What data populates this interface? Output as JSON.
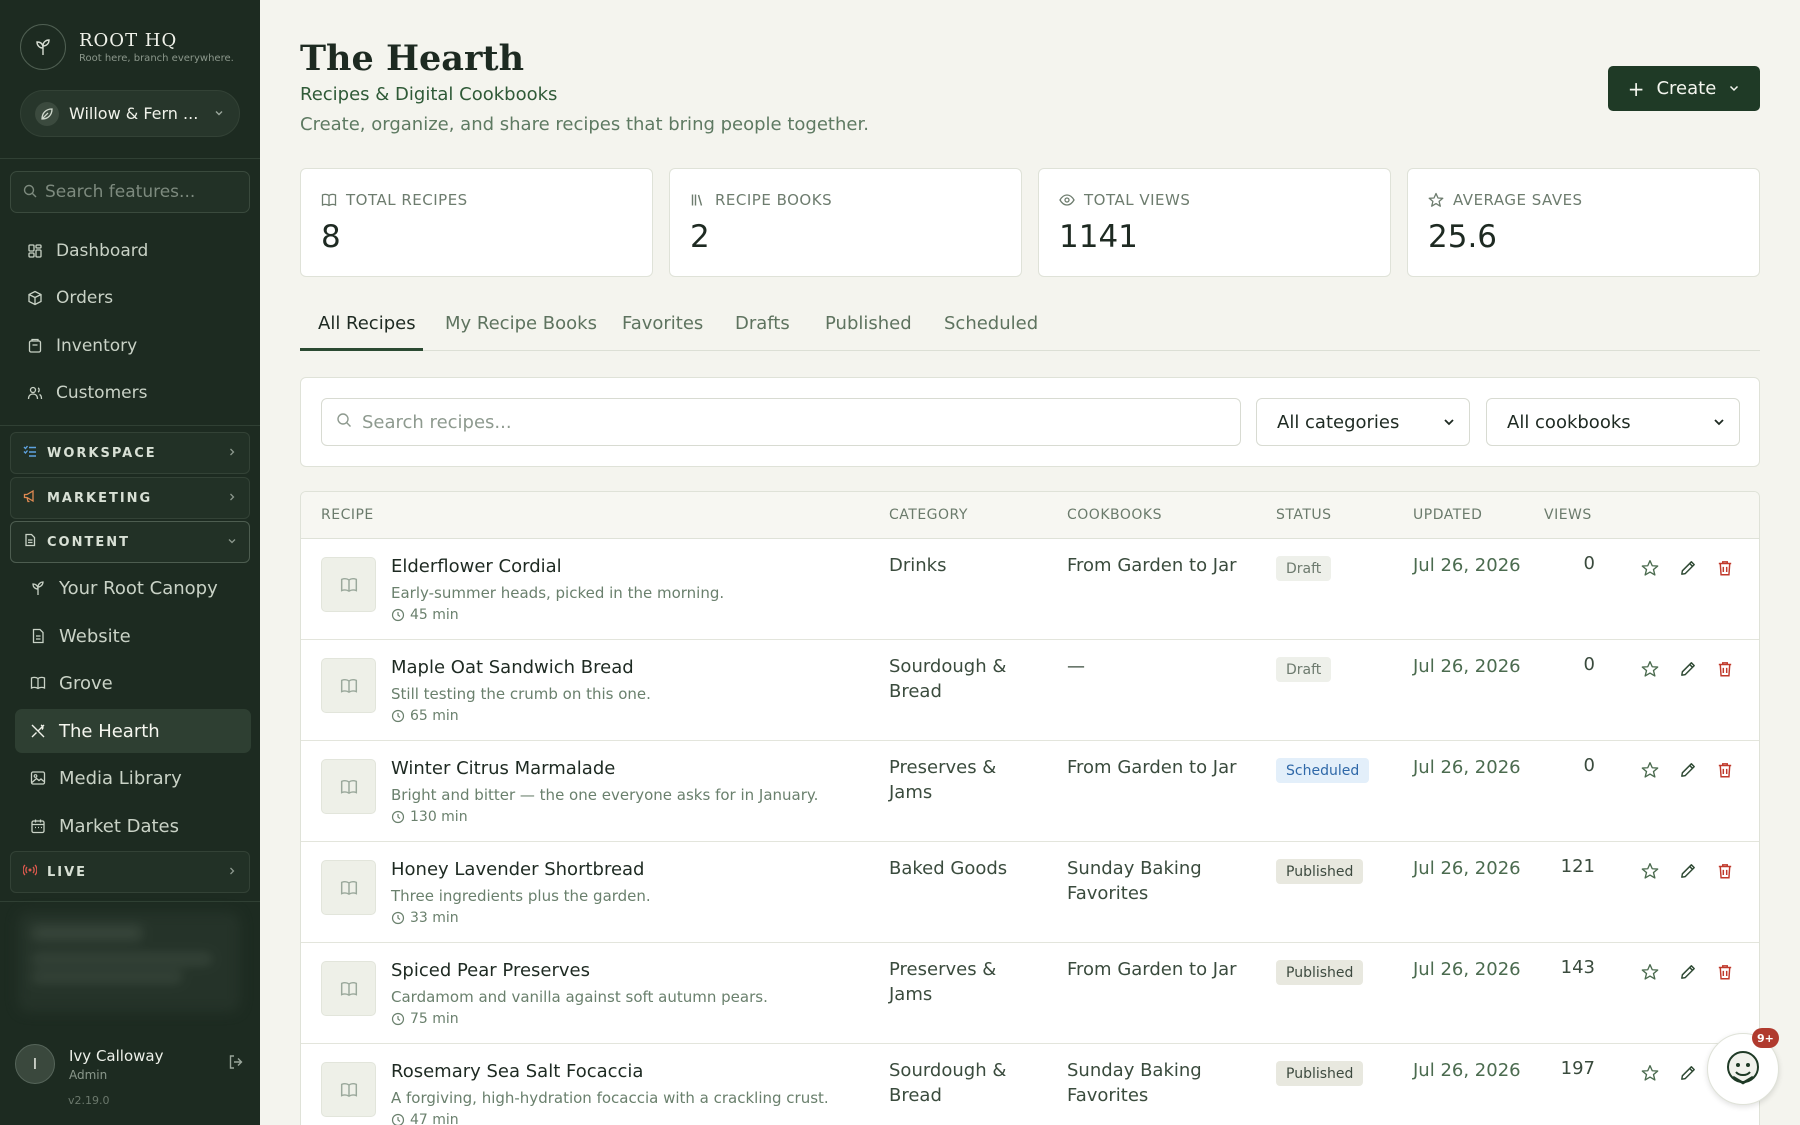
{
  "sidebar": {
    "brand_name": "ROOT HQ",
    "brand_tagline": "Root here, branch everywhere.",
    "account_name": "Willow & Fern ...",
    "search_placeholder": "Search features...",
    "nav_top": [
      {
        "label": "Dashboard",
        "icon": "dashboard-icon"
      },
      {
        "label": "Orders",
        "icon": "package-icon"
      },
      {
        "label": "Inventory",
        "icon": "inventory-icon"
      },
      {
        "label": "Customers",
        "icon": "users-icon"
      }
    ],
    "groups": [
      {
        "label": "WORKSPACE",
        "icon": "list-check-icon",
        "icon_color": "#5fa3e0"
      },
      {
        "label": "MARKETING",
        "icon": "megaphone-icon",
        "icon_color": "#e08a52"
      },
      {
        "label": "CONTENT",
        "icon": "document-icon",
        "icon_color": "#c9d2c6"
      },
      {
        "label": "LIVE",
        "icon": "broadcast-icon",
        "icon_color": "#e05a4f"
      }
    ],
    "content_items": [
      {
        "label": "Your Root Canopy",
        "icon": "sprout-icon"
      },
      {
        "label": "Website",
        "icon": "file-icon"
      },
      {
        "label": "Grove",
        "icon": "book-icon"
      },
      {
        "label": "The Hearth",
        "icon": "utensils-icon",
        "active": true
      },
      {
        "label": "Media Library",
        "icon": "image-icon"
      },
      {
        "label": "Market Dates",
        "icon": "calendar-icon"
      }
    ],
    "user": {
      "initial": "I",
      "name": "Ivy Calloway",
      "role": "Admin"
    },
    "version": "v2.19.0"
  },
  "header": {
    "title": "The Hearth",
    "subtitle": "Recipes & Digital Cookbooks",
    "description": "Create, organize, and share recipes that bring people together.",
    "create_label": "Create"
  },
  "stats": [
    {
      "label": "TOTAL RECIPES",
      "value": "8",
      "icon": "book-open-icon"
    },
    {
      "label": "RECIPE BOOKS",
      "value": "2",
      "icon": "library-icon"
    },
    {
      "label": "TOTAL VIEWS",
      "value": "1141",
      "icon": "eye-icon"
    },
    {
      "label": "AVERAGE SAVES",
      "value": "25.6",
      "icon": "star-icon"
    }
  ],
  "tabs": [
    "All Recipes",
    "My Recipe Books",
    "Favorites",
    "Drafts",
    "Published",
    "Scheduled"
  ],
  "filters": {
    "search_placeholder": "Search recipes...",
    "category_value": "All categories",
    "cookbook_value": "All cookbooks"
  },
  "table": {
    "columns": [
      "RECIPE",
      "CATEGORY",
      "COOKBOOKS",
      "STATUS",
      "UPDATED",
      "VIEWS"
    ],
    "rows": [
      {
        "name": "Elderflower Cordial",
        "desc": "Early-summer heads, picked in the morning.",
        "time": "45 min",
        "category": "Drinks",
        "cookbook": "From Garden to Jar",
        "status": "Draft",
        "updated": "Jul 26, 2026",
        "views": "0"
      },
      {
        "name": "Maple Oat Sandwich Bread",
        "desc": "Still testing the crumb on this one.",
        "time": "65 min",
        "category": "Sourdough & Bread",
        "cookbook": "—",
        "status": "Draft",
        "updated": "Jul 26, 2026",
        "views": "0"
      },
      {
        "name": "Winter Citrus Marmalade",
        "desc": "Bright and bitter — the one everyone asks for in January.",
        "time": "130 min",
        "category": "Preserves & Jams",
        "cookbook": "From Garden to Jar",
        "status": "Scheduled",
        "updated": "Jul 26, 2026",
        "views": "0"
      },
      {
        "name": "Honey Lavender Shortbread",
        "desc": "Three ingredients plus the garden.",
        "time": "33 min",
        "category": "Baked Goods",
        "cookbook": "Sunday Baking Favorites",
        "status": "Published",
        "updated": "Jul 26, 2026",
        "views": "121"
      },
      {
        "name": "Spiced Pear Preserves",
        "desc": "Cardamom and vanilla against soft autumn pears.",
        "time": "75 min",
        "category": "Preserves & Jams",
        "cookbook": "From Garden to Jar",
        "status": "Published",
        "updated": "Jul 26, 2026",
        "views": "143"
      },
      {
        "name": "Rosemary Sea Salt Focaccia",
        "desc": "A forgiving, high-hydration focaccia with a crackling crust.",
        "time": "47 min",
        "category": "Sourdough & Bread",
        "cookbook": "Sunday Baking Favorites",
        "status": "Published",
        "updated": "Jul 26, 2026",
        "views": "197"
      }
    ]
  },
  "chat": {
    "badge": "9+"
  },
  "colors": {
    "sidebar_bg": "#1d2b21",
    "accent": "#1f3a26",
    "delete": "#c0392b",
    "scheduled": "#2f68a8"
  }
}
